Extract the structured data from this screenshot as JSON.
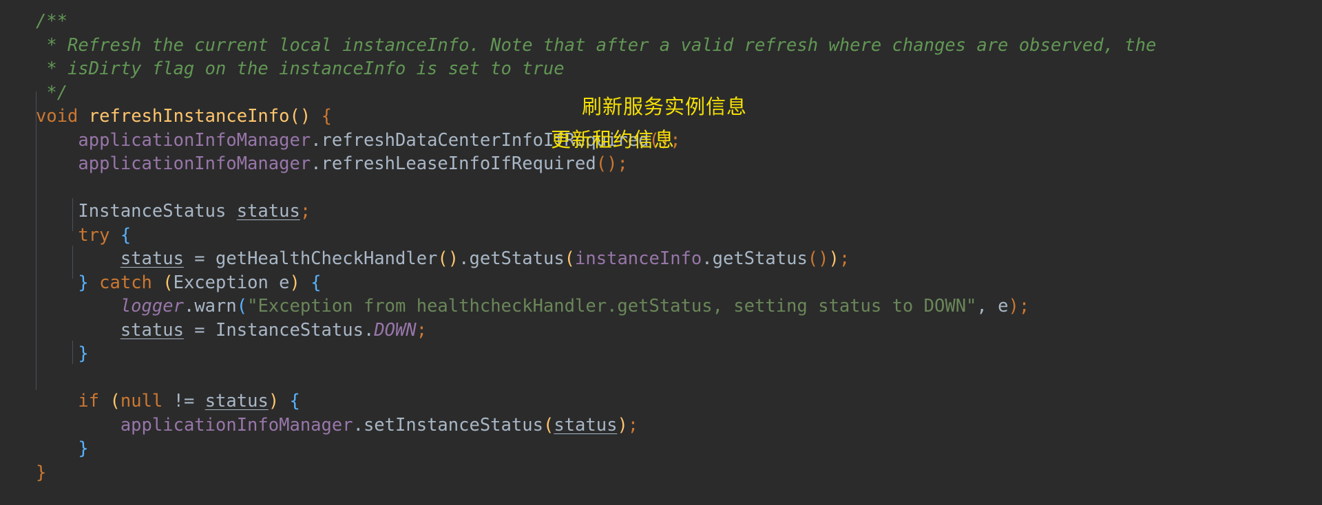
{
  "editor": {
    "language": "java",
    "background_color": "#2b2b2b",
    "default_text_color": "#a9b7c6",
    "theme": "darcula"
  },
  "colors": {
    "comment": "#629755",
    "keyword": "#cc7832",
    "method_declaration": "#ffc66d",
    "field": "#9876aa",
    "string": "#6a8759",
    "brace": "#59b2ff",
    "annotation_yellow": "#f5e005",
    "plain": "#a9b7c6"
  },
  "code": {
    "comment_block": {
      "line_1": "/**",
      "line_2": " * Refresh the current local instanceInfo. Note that after a valid refresh where changes are observed, the",
      "line_3": " * isDirty flag on the instanceInfo is set to true",
      "line_4": " */"
    },
    "signature": {
      "keyword": "void",
      "space": " ",
      "name": "refreshInstanceInfo",
      "parens": "()",
      "space2": " ",
      "brace": "{"
    },
    "line_refresh_datacenter": {
      "field": "applicationInfoManager",
      "dot": ".",
      "method": "refreshDataCenterInfoIfRequired",
      "parens": "()",
      "semi": ";"
    },
    "line_refresh_lease": {
      "field": "applicationInfoManager",
      "dot": ".",
      "method": "refreshLeaseInfoIfRequired",
      "parens": "()",
      "semi": ";"
    },
    "line_declare_status": {
      "type": "InstanceStatus",
      "space": " ",
      "var": "status",
      "semi": ";"
    },
    "line_try": {
      "keyword": "try",
      "space": " ",
      "brace": "{"
    },
    "line_get_status": {
      "var": "status",
      "assign": " = ",
      "method": "getHealthCheckHandler",
      "parens1": "()",
      "dot": ".",
      "method2": "getStatus",
      "open": "(",
      "field": "instanceInfo",
      "dot2": ".",
      "method3": "getStatus",
      "parens2": "()",
      "close": ")",
      "semi": ";"
    },
    "line_catch": {
      "close_brace": "}",
      "space": " ",
      "keyword": "catch",
      "space2": " ",
      "open": "(",
      "exception_type": "Exception",
      "space3": " ",
      "exception_var": "e",
      "close": ")",
      "space4": " ",
      "brace": "{"
    },
    "line_logger_warn": {
      "logger": "logger",
      "dot": ".",
      "method": "warn",
      "open": "(",
      "string": "\"Exception from healthcheckHandler.getStatus, setting status to DOWN\"",
      "comma": ", ",
      "arg": "e",
      "close": ")",
      "semi": ";"
    },
    "line_status_down": {
      "var": "status",
      "assign": " = ",
      "type": "InstanceStatus",
      "dot": ".",
      "constant": "DOWN",
      "semi": ";"
    },
    "line_close_catch": {
      "brace": "}"
    },
    "line_if": {
      "keyword": "if",
      "space": " ",
      "open": "(",
      "null_kw": "null",
      "op": " != ",
      "var": "status",
      "close": ")",
      "space2": " ",
      "brace": "{"
    },
    "line_set_status": {
      "field": "applicationInfoManager",
      "dot": ".",
      "method": "setInstanceStatus",
      "open": "(",
      "var": "status",
      "close": ")",
      "semi": ";"
    },
    "line_close_if": {
      "brace": "}"
    },
    "line_close_method": {
      "brace": "}"
    }
  },
  "annotations": {
    "refresh_instance_info": "刷新服务实例信息",
    "update_lease_info": "更新租约信息"
  }
}
